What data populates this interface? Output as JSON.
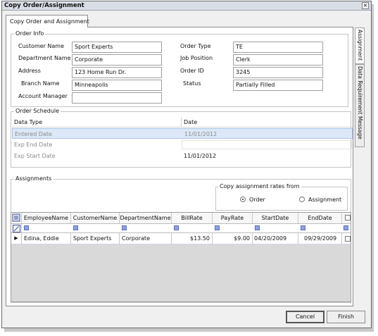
{
  "window": {
    "title": "Copy Order/Assignment",
    "close_glyph": "×"
  },
  "tab_main": "Copy Order and Assignment",
  "vertical_tabs": [
    "Assignment",
    "Data Requirement Message"
  ],
  "order_info": {
    "title": "Order Info",
    "customer_name_label": "Customer Name",
    "customer_name": "Sport Experts",
    "department_name_label": "Department Name",
    "department_name": "Corporate",
    "address_label": "Address",
    "address": "123 Home Run Dr.",
    "branch_name_label": "Branch Name",
    "branch_name": "Minneapolis",
    "account_manager_label": "Account Manager",
    "account_manager": "",
    "order_type_label": "Order Type",
    "order_type": "TE",
    "job_position_label": "Job Position",
    "job_position": "Clerk",
    "order_id_label": "Order ID",
    "order_id": "3245",
    "status_label": "Status",
    "status": "Partially Filled"
  },
  "order_schedule": {
    "title": "Order Schedule",
    "col_data_type": "Data Type",
    "col_date": "Date",
    "rows": [
      {
        "type": "Entered Date",
        "date": "11/01/2012"
      },
      {
        "type": "Exp End Date",
        "date": ""
      },
      {
        "type": "Exp Start Date",
        "date": "11/01/2012"
      }
    ]
  },
  "assignments": {
    "title": "Assignments",
    "rates_title": "Copy assignment rates from",
    "opt_order": "Order",
    "opt_assignment": "Assignment",
    "selected_option": "Order",
    "columns": [
      "EmployeeName",
      "CustomerName",
      "DepartmentName",
      "BillRate",
      "PayRate",
      "StartDate",
      "EndDate"
    ],
    "rows": [
      {
        "indicator": "▶",
        "employee": "Edina, Eddie",
        "customer": "Sport Experts",
        "department": "Corporate",
        "bill_rate": "$13.50",
        "pay_rate": "$9.00",
        "start_date": "04/20/2009",
        "end_date": "09/29/2009",
        "selected": false
      }
    ]
  },
  "buttons": {
    "cancel": "Cancel",
    "finish": "Finish"
  },
  "colors": {
    "selected_row": "#dce8f7",
    "title_bar": "#d9dde6",
    "filter_icon": "#8fa3e0"
  },
  "icons": [
    "close-icon",
    "column-chooser-icon",
    "clear-filter-icon",
    "filter-icon",
    "row-indicator-icon"
  ]
}
